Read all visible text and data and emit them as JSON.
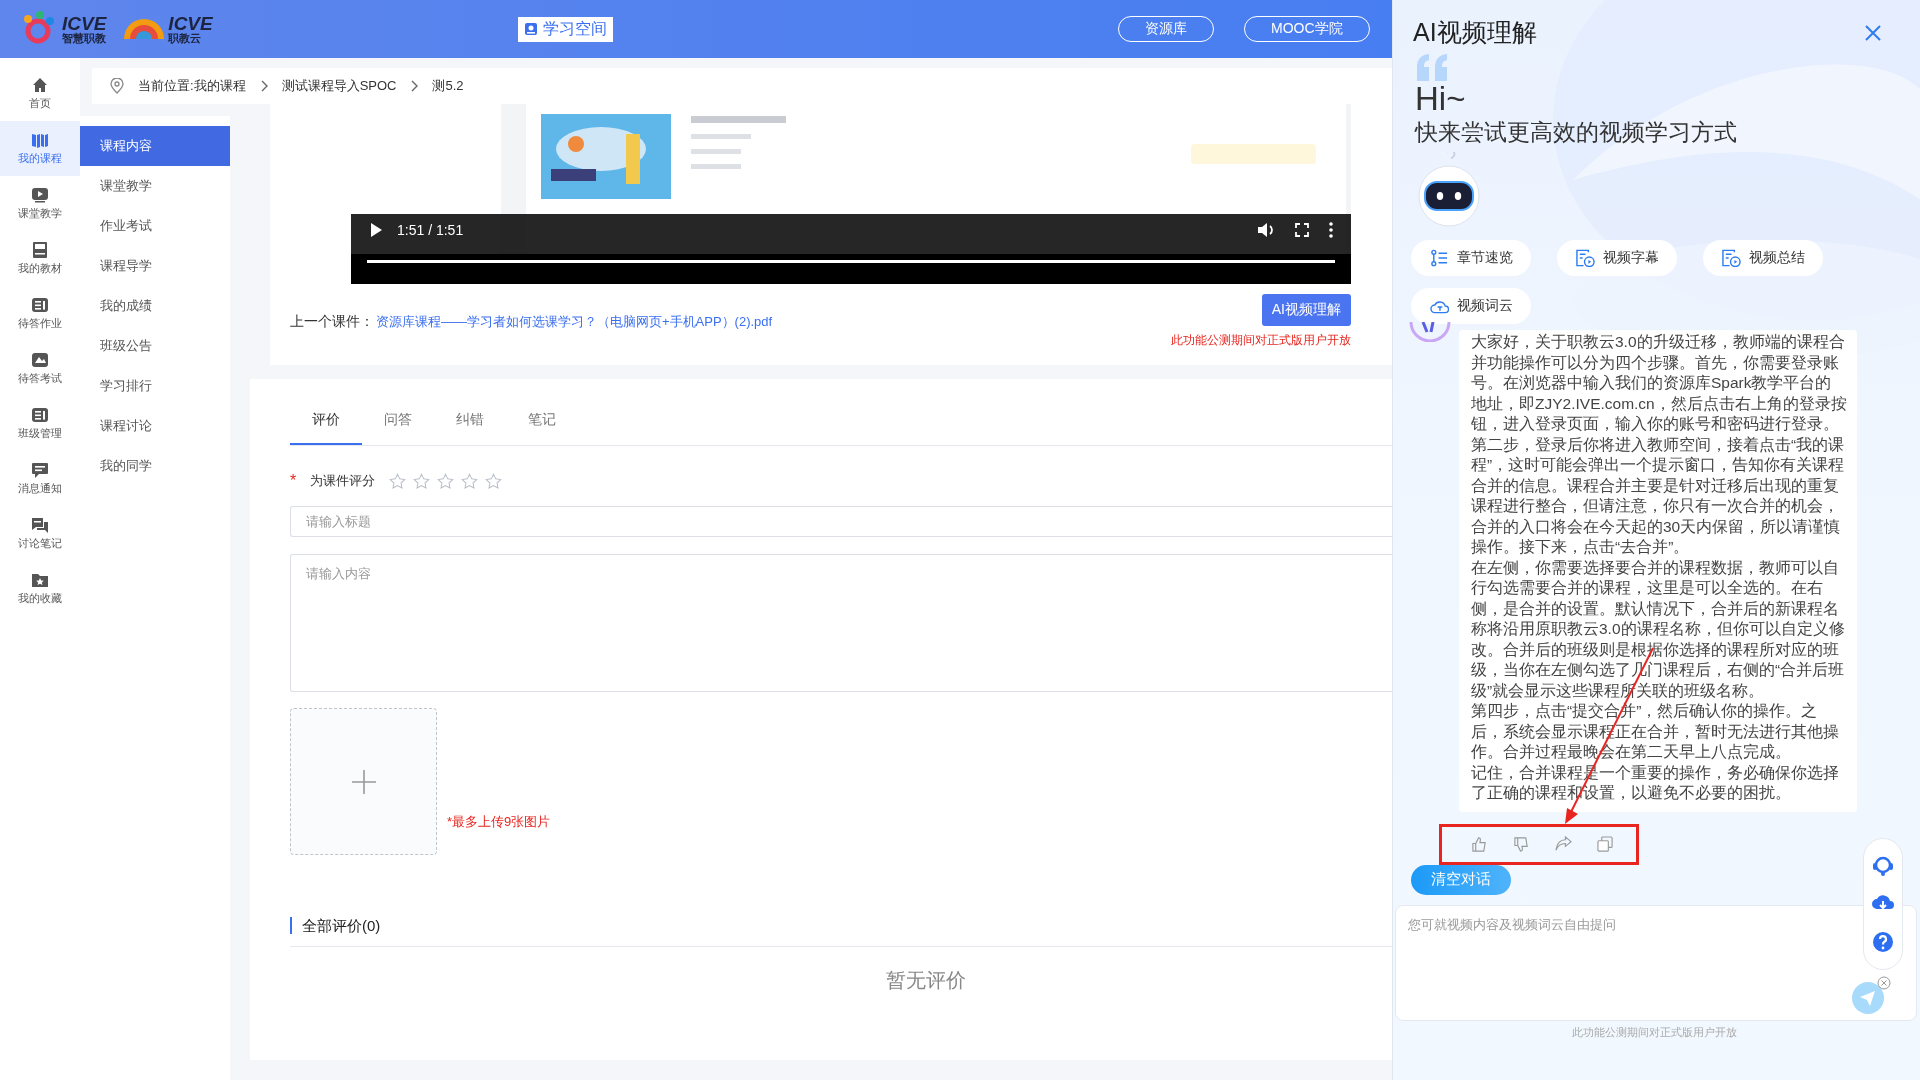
{
  "header": {
    "logos": [
      {
        "brand": "ICVE",
        "sub": "智慧职教"
      },
      {
        "brand": "ICVE",
        "sub": "职教云"
      }
    ],
    "space_tab": "学习空间",
    "links": [
      "资源库",
      "MOOC学院"
    ]
  },
  "left_nav": [
    {
      "label": "首页",
      "kind": "home",
      "selected": false
    },
    {
      "label": "我的课程",
      "kind": "book",
      "selected": true
    },
    {
      "label": "课堂教学",
      "kind": "play",
      "selected": false
    },
    {
      "label": "我的教材",
      "kind": "textbook",
      "selected": false
    },
    {
      "label": "待答作业",
      "kind": "list",
      "selected": false
    },
    {
      "label": "待答考试",
      "kind": "exam",
      "selected": false
    },
    {
      "label": "班级管理",
      "kind": "list",
      "selected": false
    },
    {
      "label": "消息通知",
      "kind": "message",
      "selected": false
    },
    {
      "label": "讨论笔记",
      "kind": "notes",
      "selected": false
    },
    {
      "label": "我的收藏",
      "kind": "star",
      "selected": false
    }
  ],
  "breadcrumb": [
    "当前位置:我的课程",
    "测试课程导入SPOC",
    "测5.2"
  ],
  "sub_menu": [
    {
      "label": "课程内容",
      "selected": true
    },
    {
      "label": "课堂教学",
      "selected": false
    },
    {
      "label": "作业考试",
      "selected": false
    },
    {
      "label": "课程导学",
      "selected": false
    },
    {
      "label": "我的成绩",
      "selected": false
    },
    {
      "label": "班级公告",
      "selected": false
    },
    {
      "label": "学习排行",
      "selected": false
    },
    {
      "label": "课程讨论",
      "selected": false
    },
    {
      "label": "我的同学",
      "selected": false
    }
  ],
  "video": {
    "kind": "picture",
    "time": "1:51 / 1:51",
    "level": 1
  },
  "prev_course": {
    "label": "上一个课件：",
    "link": "资源库课程——学习者如何选课学习？（电脑网页+手机APP）(2).pdf"
  },
  "ai_button": "AI视频理解",
  "beta_note": "此功能公测期间对正式版用户开放",
  "tabs": [
    {
      "label": "评价",
      "selected": true
    },
    {
      "label": "问答",
      "selected": false
    },
    {
      "label": "纠错",
      "selected": false
    },
    {
      "label": "笔记",
      "selected": false
    }
  ],
  "rating": {
    "required_mark": "*",
    "label": "为课件评分",
    "stars": 0
  },
  "title_field": {
    "placeholder": "请输入标题"
  },
  "content_field": {
    "placeholder": "请输入内容"
  },
  "upload_note": "*最多上传9张图片",
  "reviews": {
    "heading": "全部评价(0)",
    "empty": "暂无评价"
  },
  "ai_panel": {
    "title": "AI视频理解",
    "greeting": "Hi~",
    "subtitle": "快来尝试更高效的视频学习方式",
    "chips": [
      {
        "label": "章节速览",
        "kind": "chapters"
      },
      {
        "label": "视频字幕",
        "kind": "video"
      },
      {
        "label": "视频总结",
        "kind": "video"
      },
      {
        "label": "视频词云",
        "kind": "cloud"
      }
    ],
    "message": [
      "大家好，关于职教云3.0的升级迁移，教师端的课程合并功能操作可以分为四个步骤。首先，你需要登录账号。在浏览器中输入我们的资源库Spark教学平台的地址，即ZJY2.IVE.com.cn，然后点击右上角的登录按钮，进入登录页面，输入你的账号和密码进行登录。",
      "第二步，登录后你将进入教师空间，接着点击“我的课程”，这时可能会弹出一个提示窗口，告知你有关课程合并的信息。课程合并主要是针对迁移后出现的重复课程进行整合，但请注意，你只有一次合并的机会，合并的入口将会在今天起的30天内保留，所以请谨慎操作。接下来，点击“去合并”。",
      "在左侧，你需要选择要合并的课程数据，教师可以自行勾选需要合并的课程，这里是可以全选的。在右侧，是合并的设置。默认情况下，合并后的新课程名称将沿用原职教云3.0的课程名称，但你可以自定义修改。合并后的班级则是根据你选择的课程所对应的班级，当你在左侧勾选了几门课程后，右侧的“合并后班级”就会显示这些课程所关联的班级名称。",
      "第四步，点击“提交合并”，然后确认你的操作。之后，系统会显示课程正在合并，暂时无法进行其他操作。合并过程最晚会在第二天早上八点完成。",
      "记住，合并课程是一个重要的操作，务必确保你选择了正确的课程和设置，以避免不必要的困扰。"
    ],
    "clear_button": "清空对话",
    "input": {
      "placeholder": "您可就视频内容及视频词云自由提问"
    },
    "footer_note": "此功能公测期间对正式版用户开放"
  }
}
